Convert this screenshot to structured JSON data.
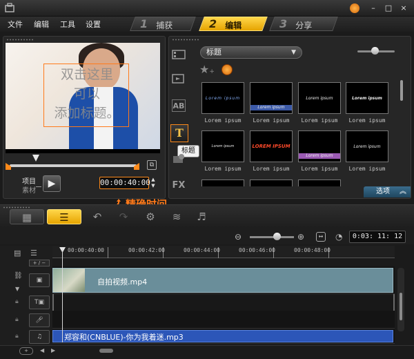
{
  "menu": {
    "items": [
      "文件",
      "编辑",
      "工具",
      "设置"
    ]
  },
  "steps": [
    {
      "num": "1",
      "label": "捕获"
    },
    {
      "num": "2",
      "label": "编辑"
    },
    {
      "num": "3",
      "label": "分享"
    }
  ],
  "window": {
    "min": "–",
    "max": "□",
    "close": "×"
  },
  "preview": {
    "title_lines": [
      "双击这里",
      "可以",
      "添加标题。"
    ],
    "mode_project": "项目",
    "mode_clip": "素材",
    "timecode": "00:00:40:00",
    "annotation": "精确时间"
  },
  "library": {
    "category": "标题",
    "tooltip": "标题",
    "side_icons": [
      "film",
      "media",
      "AB",
      "T",
      "graphics",
      "FX"
    ],
    "side_labels": {
      "ab": "AB",
      "title": "T",
      "fx": "FX"
    },
    "thumbnails": [
      {
        "caption": "Lorem ipsum",
        "text": "Lorem ipsum"
      },
      {
        "caption": "Lorem ipsum",
        "text": "Lorem ipsum"
      },
      {
        "caption": "Lorem ipsum",
        "text": "Lorem ipsum"
      },
      {
        "caption": "Lorem ipsum",
        "text": "Lorem ipsum"
      },
      {
        "caption": "Lorem ipsum",
        "text": "Lorem ipsum"
      },
      {
        "caption": "Lorem ipsum",
        "text": "LOREM IPSUM"
      },
      {
        "caption": "Lorem ipsum",
        "text": "Lorem ipsum"
      },
      {
        "caption": "Lorem ipsum",
        "text": "Lorem ipsum"
      }
    ],
    "options_label": "选项"
  },
  "timeline": {
    "duration": "0:03: 11: 12",
    "ruler": [
      "00:00:40:00",
      "00:00:42:00",
      "00:00:44:00",
      "00:00:46:00",
      "00:00:48:00"
    ],
    "video_clip": "自拍视频.mp4",
    "music_clip": "郑容和(CNBLUE)-你为我着迷.mp3",
    "add_track": "+ / −"
  },
  "colors": {
    "accent_orange": "#ff7a1a",
    "active_step": "#f2b81a",
    "video_clip": "#6a8e9a",
    "music_clip": "#2c56b8"
  }
}
